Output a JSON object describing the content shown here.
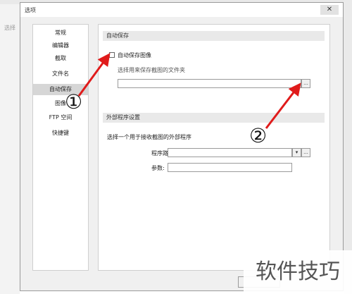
{
  "app": {
    "left_label": "选择"
  },
  "dialog": {
    "title": "选项",
    "close_glyph": "✕"
  },
  "nav": {
    "items": [
      {
        "label": "常规",
        "selected": false
      },
      {
        "label": "编辑器",
        "selected": false
      },
      {
        "label": "截取",
        "selected": false
      },
      {
        "label": "文件名",
        "selected": false
      },
      {
        "label": "自动保存",
        "selected": true
      },
      {
        "label": "图像",
        "selected": false
      },
      {
        "label": "FTP 空间",
        "selected": false
      },
      {
        "label": "快捷键",
        "selected": false
      }
    ]
  },
  "auto_save": {
    "section_title": "自动保存",
    "checkbox_label": "自动保存图像",
    "checked": false,
    "folder_prompt": "选择用来保存截图的文件夹",
    "folder_value": "",
    "browse_label": "..."
  },
  "external_program": {
    "section_title": "外部程序设置",
    "description": "选择一个用于接收截图的外部程序",
    "path_label": "程序路径:",
    "path_value": "",
    "dropdown_glyph": "▾",
    "browse_label": "...",
    "args_label": "参数:",
    "args_value": ""
  },
  "annotations": {
    "one": "①",
    "two": "②",
    "arrow_color": "#e01b1b"
  },
  "watermark": {
    "text": "软件技巧"
  }
}
